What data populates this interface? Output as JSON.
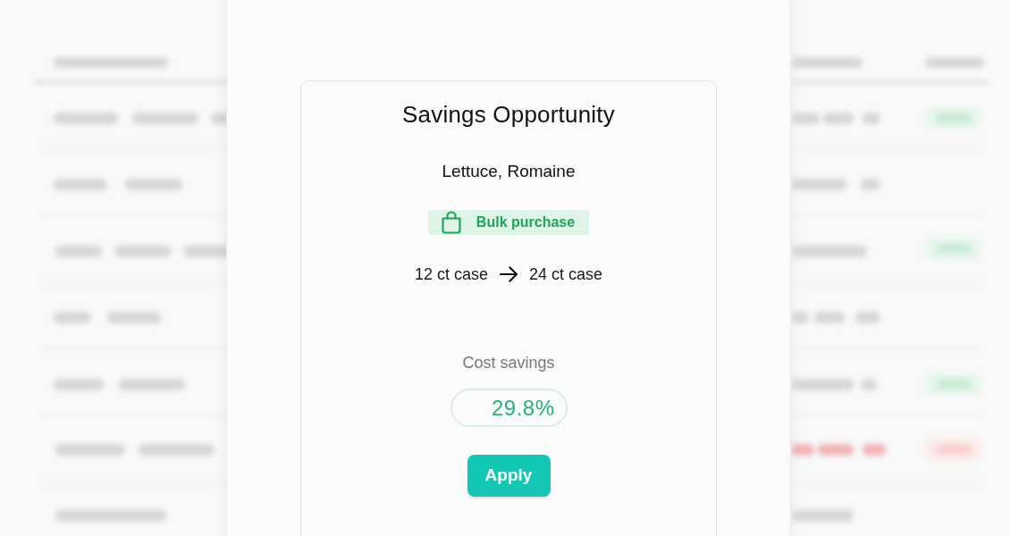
{
  "card": {
    "title": "Savings Opportunity",
    "item": "Lettuce, Romaine",
    "tag": {
      "label": "Bulk purchase"
    },
    "change": {
      "from": "12 ct case",
      "to": "24 ct case"
    },
    "savings": {
      "label": "Cost savings",
      "value": "29.8%"
    },
    "button": "Apply"
  }
}
